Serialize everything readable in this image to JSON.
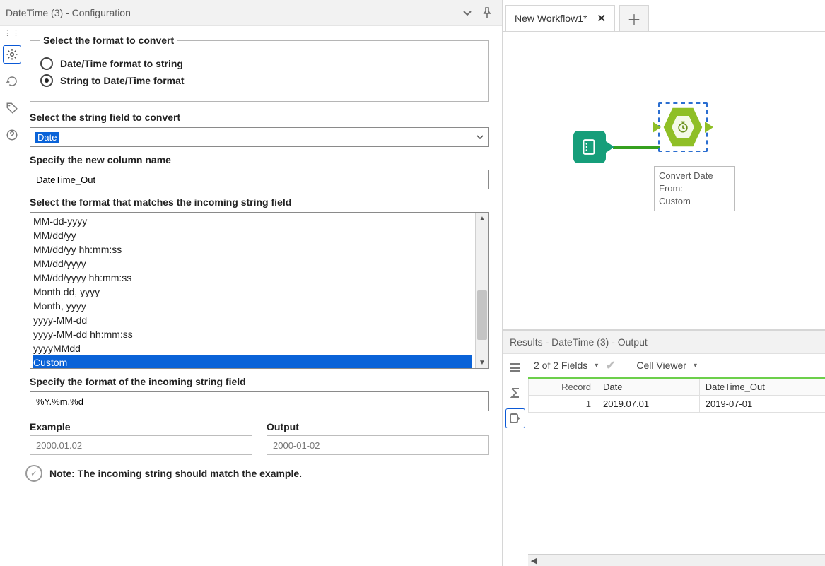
{
  "config_panel": {
    "title": "DateTime (3) - Configuration",
    "format_group": {
      "legend": "Select the format to convert",
      "options": [
        {
          "label": "Date/Time format to string",
          "checked": false
        },
        {
          "label": "String to Date/Time format",
          "checked": true
        }
      ]
    },
    "string_field": {
      "label": "Select the string field to convert",
      "value": "Date"
    },
    "new_column": {
      "label": "Specify the new column name",
      "value": "DateTime_Out"
    },
    "format_list": {
      "label": "Select the format that matches the incoming string field",
      "items": [
        "MM-dd-yyyy",
        "MM/dd/yy",
        "MM/dd/yy hh:mm:ss",
        "MM/dd/yyyy",
        "MM/dd/yyyy hh:mm:ss",
        "Month dd, yyyy",
        "Month, yyyy",
        "yyyy-MM-dd",
        "yyyy-MM-dd hh:mm:ss",
        "yyyyMMdd",
        "Custom"
      ],
      "selected": "Custom"
    },
    "custom_format": {
      "label": "Specify the format of the incoming string field",
      "value": "%Y.%m.%d"
    },
    "example": {
      "example_label": "Example",
      "example_value": "2000.01.02",
      "output_label": "Output",
      "output_value": "2000-01-02"
    },
    "note": "Note: The incoming string should match the example."
  },
  "workflow": {
    "tab_name": "New Workflow1*",
    "tool_label_line1": "Convert Date",
    "tool_label_line2": "From:",
    "tool_label_line3": "Custom"
  },
  "results": {
    "title": "Results - DateTime (3) - Output",
    "fields_summary": "2 of 2 Fields",
    "cell_viewer": "Cell Viewer",
    "columns": [
      "Record",
      "Date",
      "DateTime_Out"
    ],
    "rows": [
      {
        "record": "1",
        "Date": "2019.07.01",
        "DateTime_Out": "2019-07-01"
      }
    ]
  }
}
